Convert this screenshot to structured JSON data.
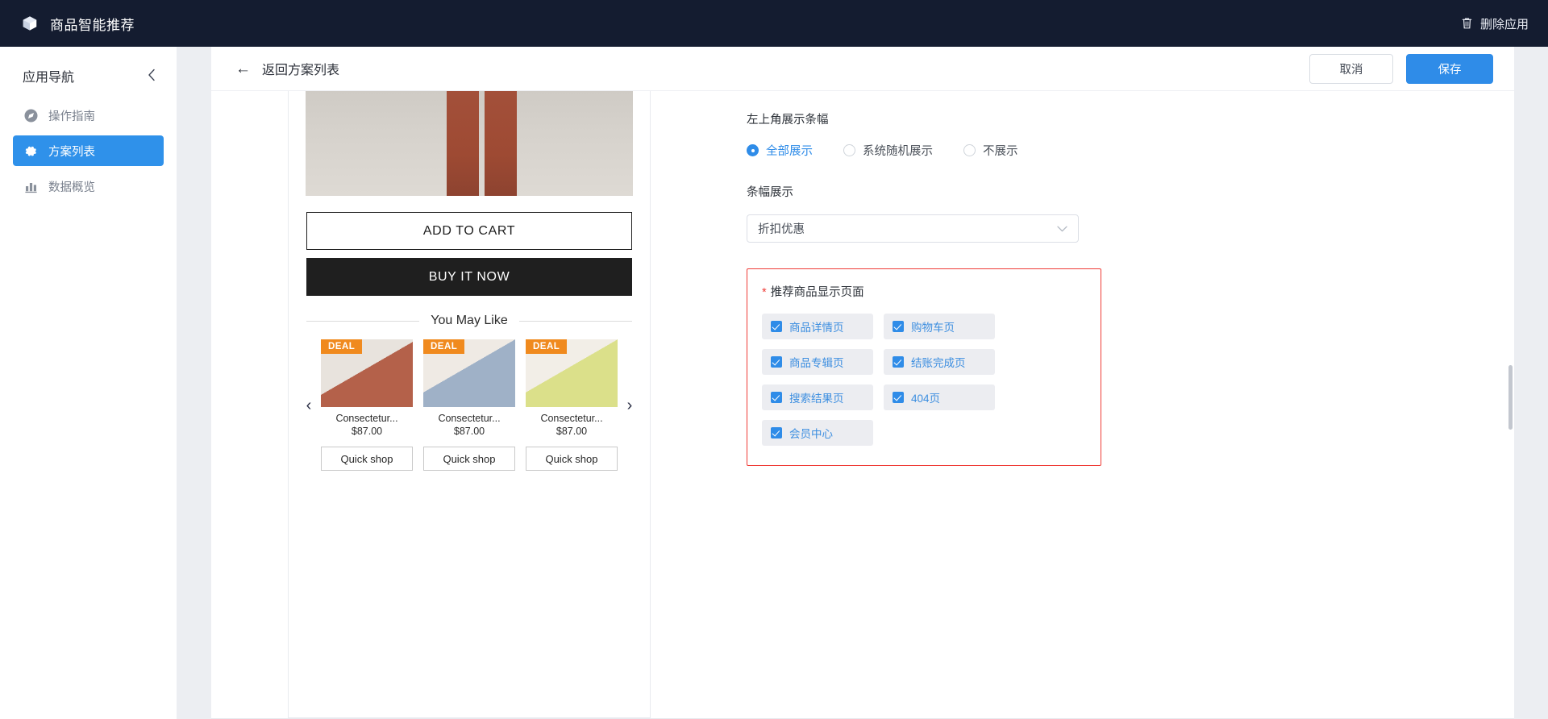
{
  "topbar": {
    "brand_icon": "cube-icon",
    "title": "商品智能推荐",
    "delete_label": "删除应用",
    "delete_icon": "trash-icon",
    "bg_color": "#141c30"
  },
  "sidebar": {
    "title": "应用导航",
    "collapse_icon": "chevron-left-icon",
    "items": [
      {
        "label": "操作指南",
        "icon": "compass-icon",
        "active": false
      },
      {
        "label": "方案列表",
        "icon": "gear-icon",
        "active": true
      },
      {
        "label": "数据概览",
        "icon": "bar-chart-icon",
        "active": false
      }
    ],
    "active_color": "#2f91ea"
  },
  "panel": {
    "back_label": "返回方案列表",
    "back_icon": "arrow-left-icon",
    "cancel_label": "取消",
    "save_label": "保存",
    "primary_color": "#2f8ce8"
  },
  "preview": {
    "add_to_cart_label": "ADD TO CART",
    "buy_now_label": "BUY IT NOW",
    "section_title": "You May Like",
    "prev_icon": "chevron-left-icon",
    "next_icon": "chevron-right-icon",
    "badge_label": "DEAL",
    "badge_color": "#f08a1e",
    "products": [
      {
        "title": "Consectetur...",
        "price": "$87.00",
        "button": "Quick shop"
      },
      {
        "title": "Consectetur...",
        "price": "$87.00",
        "button": "Quick shop"
      },
      {
        "title": "Consectetur...",
        "price": "$87.00",
        "button": "Quick shop"
      }
    ]
  },
  "form": {
    "banner_position_label": "左上角展示条幅",
    "banner_options": [
      {
        "label": "全部展示",
        "selected": true
      },
      {
        "label": "系统随机展示",
        "selected": false
      },
      {
        "label": "不展示",
        "selected": false
      }
    ],
    "banner_display_label": "条幅展示",
    "banner_select_value": "折扣优惠",
    "select_chevron_icon": "chevron-down-icon",
    "pages_section": {
      "required_mark": "*",
      "title": "推荐商品显示页面",
      "border_color": "#ef3b36",
      "options": [
        {
          "label": "商品详情页",
          "checked": true
        },
        {
          "label": "购物车页",
          "checked": true
        },
        {
          "label": "商品专辑页",
          "checked": true
        },
        {
          "label": "结账完成页",
          "checked": true
        },
        {
          "label": "搜索结果页",
          "checked": true
        },
        {
          "label": "404页",
          "checked": true
        },
        {
          "label": "会员中心",
          "checked": true
        }
      ]
    }
  }
}
